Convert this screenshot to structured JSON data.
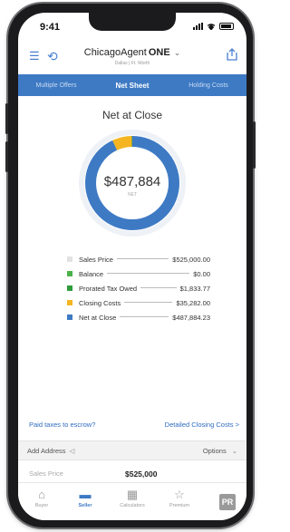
{
  "status_bar": {
    "time": "9:41"
  },
  "header": {
    "app_name": "ChicagoAgent",
    "app_name_bold": "ONE",
    "caret": "⌄",
    "subtitle": "Dallas | Ft. Worth"
  },
  "tabs": [
    {
      "label": "Multiple Offers",
      "active": false
    },
    {
      "label": "Net Sheet",
      "active": true
    },
    {
      "label": "Holding Costs",
      "active": false
    }
  ],
  "net_sheet": {
    "title": "Net at Close",
    "center_value": "$487,884",
    "center_sub": "NET"
  },
  "chart_data": {
    "type": "pie",
    "style": "donut",
    "title": "Net at Close",
    "categories": [
      "Sales Price",
      "Balance",
      "Prorated Tax Owed",
      "Closing Costs",
      "Net at Close"
    ],
    "values": [
      525000.0,
      0.0,
      1833.77,
      35282.0,
      487884.23
    ],
    "display_values": [
      "$525,000.00",
      "$0.00",
      "$1,833.77",
      "$35,282.00",
      "$487,884.23"
    ],
    "colors": [
      "#e2e2e2",
      "#4bb04a",
      "#2f9c3b",
      "#f4b521",
      "#3e7ac4"
    ],
    "ring_segments": [
      {
        "category": "Net at Close",
        "value": 487884.23,
        "color": "#3e7ac4"
      },
      {
        "category": "Closing Costs",
        "value": 35282.0,
        "color": "#f4b521"
      },
      {
        "category": "Prorated Tax Owed",
        "value": 1833.77,
        "color": "#2f9c3b"
      }
    ],
    "legend_placement": "below"
  },
  "links": {
    "paid_taxes": "Paid taxes to escrow?",
    "detailed_closing": "Detailed Closing Costs >"
  },
  "address_bar": {
    "add_address": "Add Address",
    "options": "Options"
  },
  "sales_row": {
    "label": "Sales Price",
    "value": "$525,000"
  },
  "bottom_nav": {
    "items": [
      {
        "label": "Buyer",
        "icon": "house-icon",
        "active": false
      },
      {
        "label": "Seller",
        "icon": "seller-icon",
        "active": true
      },
      {
        "label": "Calculators",
        "icon": "calculator-icon",
        "active": false
      },
      {
        "label": "Premium",
        "icon": "star-icon",
        "active": false
      }
    ],
    "logo_text": "PR"
  }
}
